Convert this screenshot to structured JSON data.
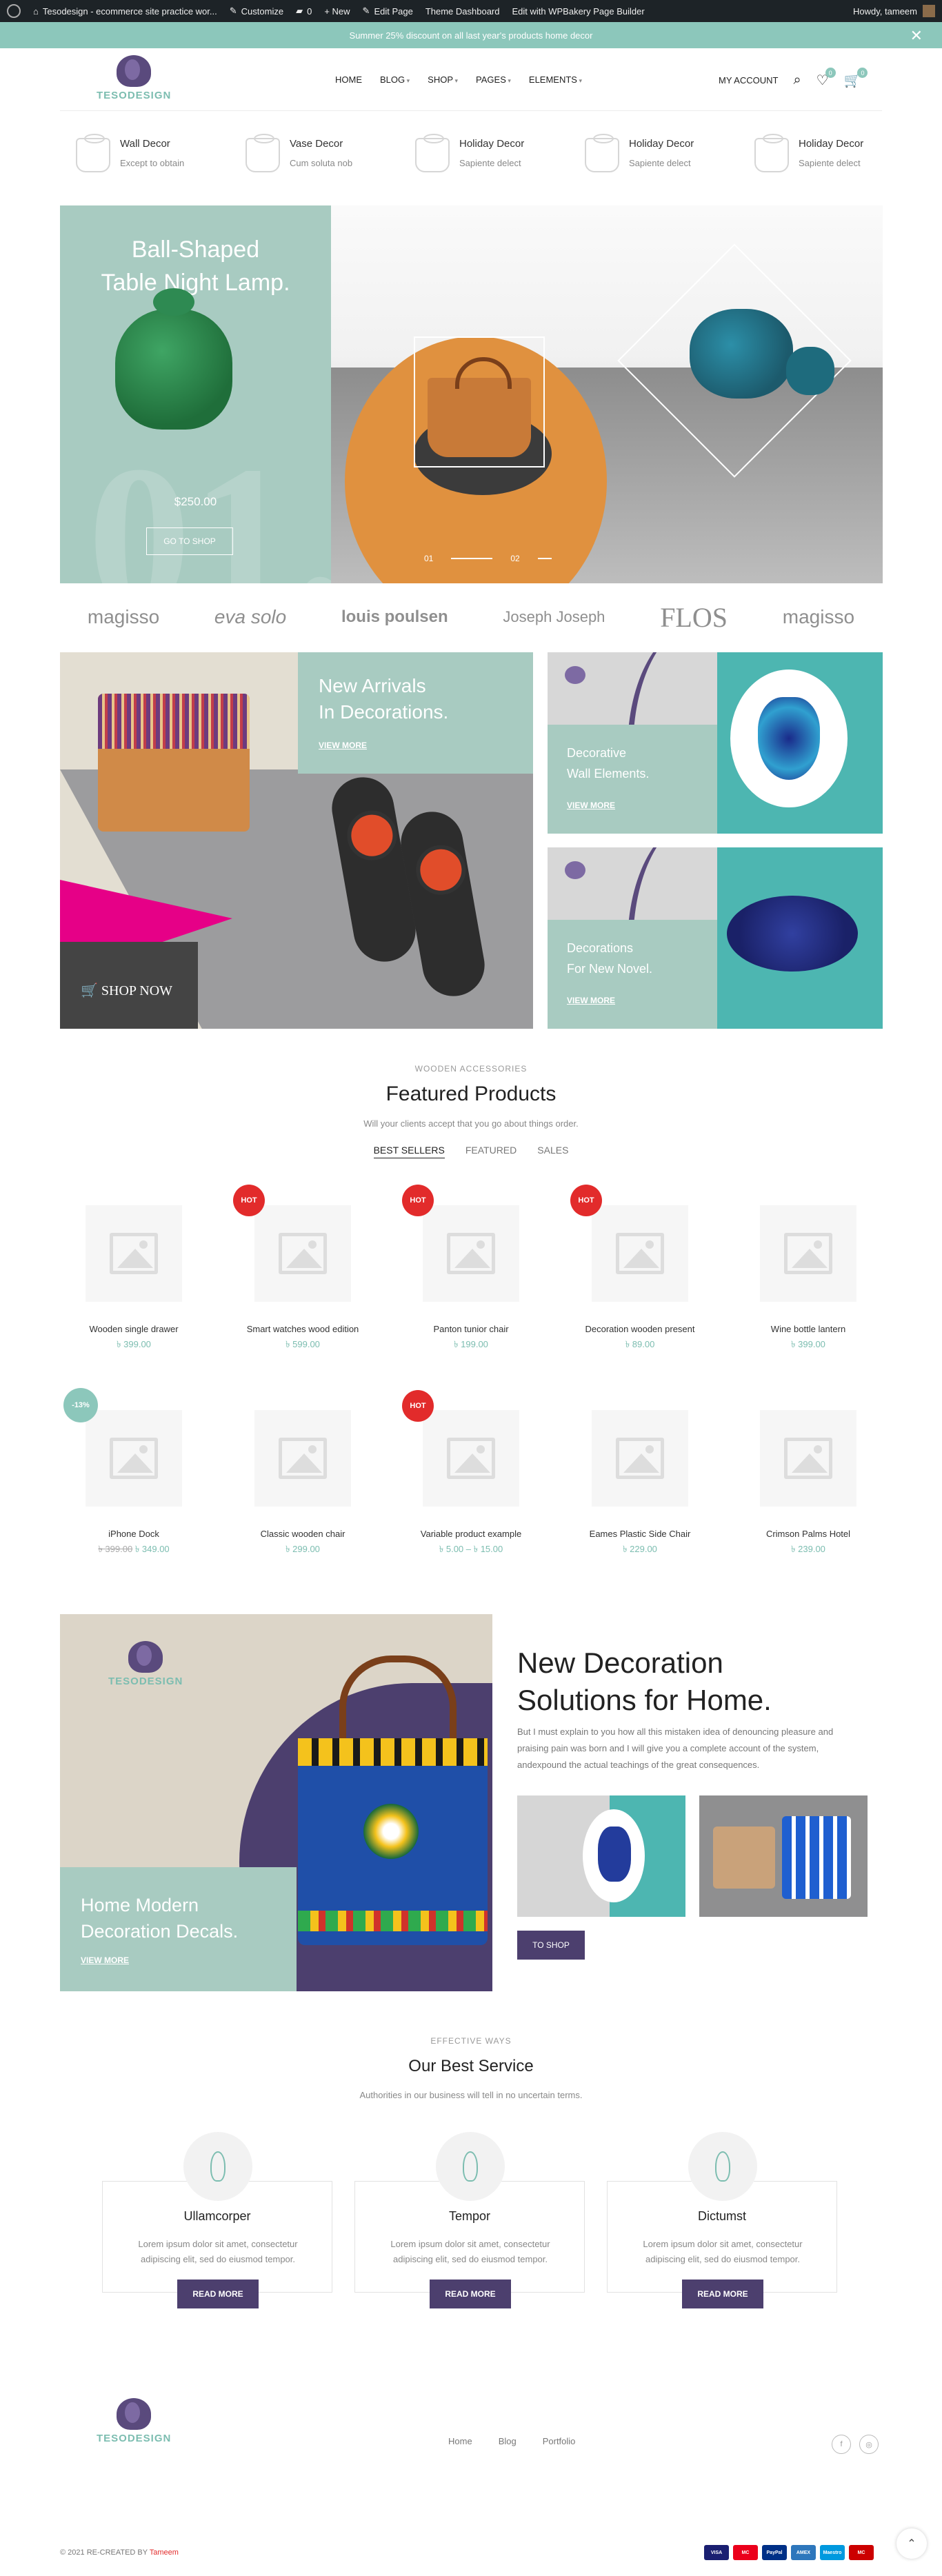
{
  "adminbar": {
    "site": "Tesodesign - ecommerce site practice wor...",
    "customize": "Customize",
    "comments": "0",
    "new": "+ New",
    "edit_page": "Edit Page",
    "theme_dashboard": "Theme Dashboard",
    "wpbakery": "Edit with WPBakery Page Builder",
    "howdy": "Howdy, tameem"
  },
  "promo": {
    "text": "Summer 25% discount on all last year's products home decor",
    "close": "✕"
  },
  "header": {
    "logo_text": "TESODESIGN",
    "nav": [
      "HOME",
      "BLOG",
      "SHOP",
      "PAGES",
      "ELEMENTS"
    ],
    "my_account": "MY ACCOUNT",
    "wishlist_count": "0",
    "cart_count": "0",
    "colors": {
      "accent": "#8cc7bb",
      "brand_purple": "#4c3f6e"
    }
  },
  "features": [
    {
      "title": "Wall Decor",
      "sub": "Except to obtain",
      "icon": "lamp-icon"
    },
    {
      "title": "Vase Decor",
      "sub": "Cum soluta nob",
      "icon": "lamp-icon"
    },
    {
      "title": "Holiday Decor",
      "sub": "Sapiente delect",
      "icon": "lamp-icon"
    },
    {
      "title": "Holiday Decor",
      "sub": "Sapiente delect",
      "icon": "lamp-icon"
    },
    {
      "title": "Holiday Decor",
      "sub": "Sapiente delect",
      "icon": "lamp-icon"
    }
  ],
  "hero": {
    "title_line1": "Ball-Shaped",
    "title_line2": "Table Night Lamp.",
    "bg_number": "01.",
    "price": "$250.00",
    "button": "GO TO SHOP",
    "slide1": "01",
    "slide2": "02"
  },
  "brands": [
    "magisso",
    "eva solo",
    "louis poulsen",
    "Joseph Joseph",
    "FLOS",
    "magisso"
  ],
  "banners": {
    "big_line1": "New Arrivals",
    "big_line2": "In Decorations.",
    "big_link": "VIEW MORE",
    "shop_now": "SHOP NOW",
    "small1_line1": "Decorative",
    "small1_line2": "Wall Elements.",
    "small1_link": "VIEW MORE",
    "small2_line1": "Decorations",
    "small2_line2": "For New Novel.",
    "small2_link": "VIEW MORE"
  },
  "featured": {
    "subtitle": "WOODEN ACCESSORIES",
    "title": "Featured Products",
    "desc": "Will your clients accept that you go about things order.",
    "tabs": [
      "BEST SELLERS",
      "FEATURED",
      "SALES"
    ],
    "products": [
      {
        "name": "Wooden single drawer",
        "price": "৳ 399.00",
        "old": "",
        "badge": ""
      },
      {
        "name": "Smart watches wood edition",
        "price": "৳ 599.00",
        "old": "",
        "badge": "HOT"
      },
      {
        "name": "Panton tunior chair",
        "price": "৳ 199.00",
        "old": "",
        "badge": "HOT"
      },
      {
        "name": "Decoration wooden present",
        "price": "৳ 89.00",
        "old": "",
        "badge": "HOT"
      },
      {
        "name": "Wine bottle lantern",
        "price": "৳ 399.00",
        "old": "",
        "badge": ""
      },
      {
        "name": "iPhone Dock",
        "price": "৳ 349.00",
        "old": "৳ 399.00",
        "badge": "-13%"
      },
      {
        "name": "Classic wooden chair",
        "price": "৳ 299.00",
        "old": "",
        "badge": ""
      },
      {
        "name": "Variable product example",
        "price": "৳ 5.00 – ৳ 15.00",
        "old": "",
        "badge": "HOT"
      },
      {
        "name": "Eames Plastic Side Chair",
        "price": "৳ 229.00",
        "old": "",
        "badge": ""
      },
      {
        "name": "Crimson Palms Hotel",
        "price": "৳ 239.00",
        "old": "",
        "badge": ""
      }
    ]
  },
  "decoration": {
    "logo_text": "TESODESIGN",
    "mint_line1": "Home Modern",
    "mint_line2": "Decoration Decals.",
    "mint_link": "VIEW MORE",
    "title_line1": "New Decoration",
    "title_line2": "Solutions for Home.",
    "paragraph": "But I must explain to you how all this mistaken idea of denouncing pleasure and praising pain was born and I will give you a complete account of the system, andexpound the actual teachings of the great consequences.",
    "button": "TO SHOP"
  },
  "services": {
    "subtitle": "EFFECTIVE WAYS",
    "title": "Our Best Service",
    "desc": "Authorities in our business will tell in no uncertain terms.",
    "items": [
      {
        "title": "Ullamcorper",
        "text": "Lorem ipsum dolor sit amet, consectetur adipiscing elit, sed do eiusmod tempor.",
        "button": "READ MORE"
      },
      {
        "title": "Tempor",
        "text": "Lorem ipsum dolor sit amet, consectetur adipiscing elit, sed do eiusmod tempor.",
        "button": "READ MORE"
      },
      {
        "title": "Dictumst",
        "text": "Lorem ipsum dolor sit amet, consectetur adipiscing elit, sed do eiusmod tempor.",
        "button": "READ MORE"
      }
    ]
  },
  "footer": {
    "logo_text": "TESODESIGN",
    "nav": [
      "Home",
      "Blog",
      "Portfolio"
    ],
    "social": [
      "f",
      "◎"
    ],
    "copyright": "© 2021 RE-CREATED BY",
    "author": "Tameem",
    "payments": [
      "VISA",
      "MC",
      "PayPal",
      "AMEX",
      "Maestro",
      "MC"
    ],
    "to_top": "⌃"
  }
}
